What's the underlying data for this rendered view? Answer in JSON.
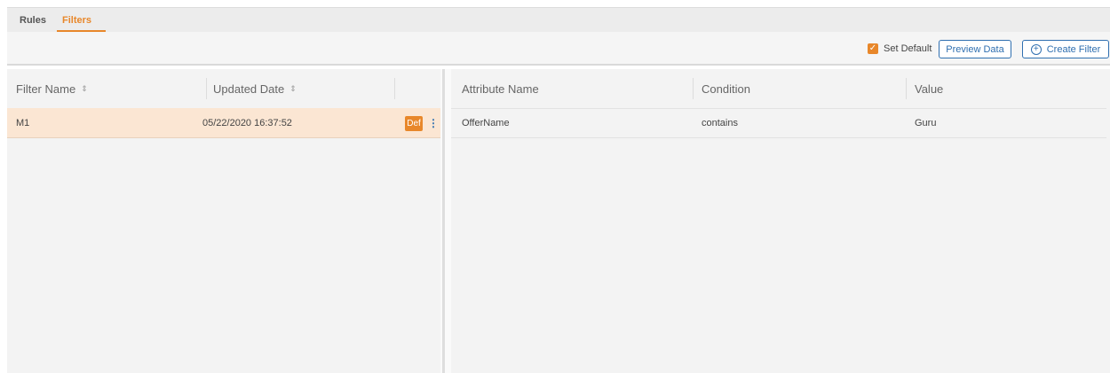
{
  "tabs": [
    {
      "label": "Rules",
      "active": false
    },
    {
      "label": "Filters",
      "active": true
    }
  ],
  "toolbar": {
    "set_default_label": "Set Default",
    "set_default_checked": true,
    "preview_label": "Preview Data",
    "create_label": "Create Filter"
  },
  "left_table": {
    "headers": [
      "Filter Name",
      "Updated Date"
    ],
    "rows": [
      {
        "name": "M1",
        "updated": "05/22/2020 16:37:52",
        "badge": "Def"
      }
    ]
  },
  "right_table": {
    "headers": [
      "Attribute Name",
      "Condition",
      "Value"
    ],
    "rows": [
      {
        "attribute": "OfferName",
        "condition": "contains",
        "value": "Guru"
      }
    ]
  },
  "colors": {
    "accent": "#e8872a",
    "primary": "#2f6fb0",
    "selected_row": "#fbe6d3"
  }
}
